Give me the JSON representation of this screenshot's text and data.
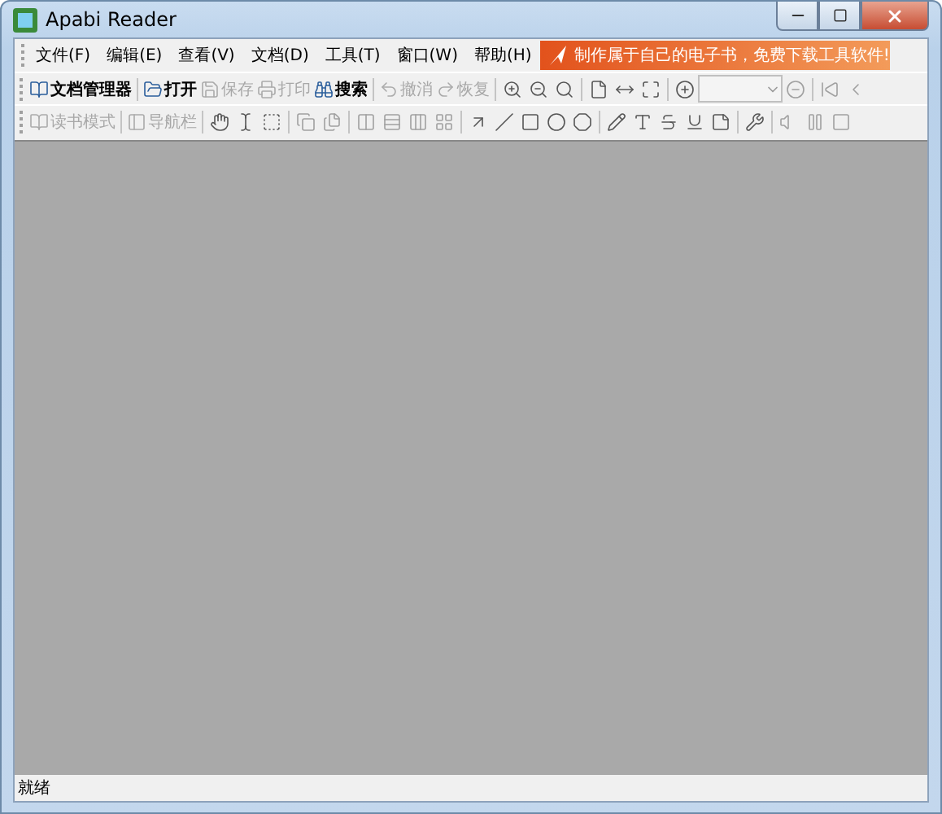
{
  "window": {
    "title": "Apabi Reader"
  },
  "menu": [
    {
      "label": "文件(F)"
    },
    {
      "label": "编辑(E)"
    },
    {
      "label": "查看(V)"
    },
    {
      "label": "文档(D)"
    },
    {
      "label": "工具(T)"
    },
    {
      "label": "窗口(W)"
    },
    {
      "label": "帮助(H)"
    }
  ],
  "banner": {
    "text": "制作属于自己的电子书，免费下载工具软件!"
  },
  "toolbar_1": [
    {
      "label": "文档管理器",
      "disabled": false
    },
    {
      "label": "打开",
      "disabled": false
    },
    {
      "label": "保存",
      "disabled": true
    },
    {
      "label": "打印",
      "disabled": true
    },
    {
      "label": "搜索",
      "disabled": false
    },
    {
      "label": "撤消",
      "disabled": true
    },
    {
      "label": "恢复",
      "disabled": true
    }
  ],
  "toolbar_2": [
    {
      "label": "读书模式",
      "disabled": true
    },
    {
      "label": "导航栏",
      "disabled": true
    }
  ],
  "status_bar": {
    "text": "就绪"
  }
}
